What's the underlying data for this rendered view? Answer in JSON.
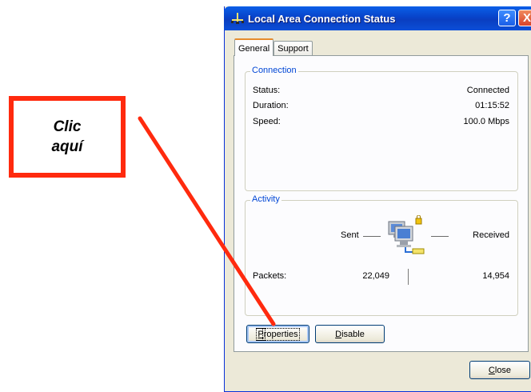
{
  "annotation": {
    "line1": "Clic",
    "line2": "aquí"
  },
  "window": {
    "title": "Local Area Connection Status",
    "help_button": "?",
    "close_button": "X",
    "title_icon": "network-connection-icon"
  },
  "tabs": [
    {
      "label": "General",
      "active": true
    },
    {
      "label": "Support",
      "active": false
    }
  ],
  "connection": {
    "legend": "Connection",
    "status_label": "Status:",
    "status_value": "Connected",
    "duration_label": "Duration:",
    "duration_value": "01:15:52",
    "speed_label": "Speed:",
    "speed_value": "100.0 Mbps"
  },
  "activity": {
    "legend": "Activity",
    "sent_label": "Sent",
    "received_label": "Received",
    "packets_label": "Packets:",
    "packets_sent": "22,049",
    "packets_received": "14,954",
    "icon": "network-computers-icon"
  },
  "buttons": {
    "properties_accel": "P",
    "properties_rest": "roperties",
    "disable_accel": "D",
    "disable_rest": "isable",
    "close_accel": "C",
    "close_rest": "lose"
  },
  "colors": {
    "annotation_red": "#ff2a0e",
    "titlebar_blue": "#0a5fe8",
    "group_legend": "#0046d5"
  }
}
